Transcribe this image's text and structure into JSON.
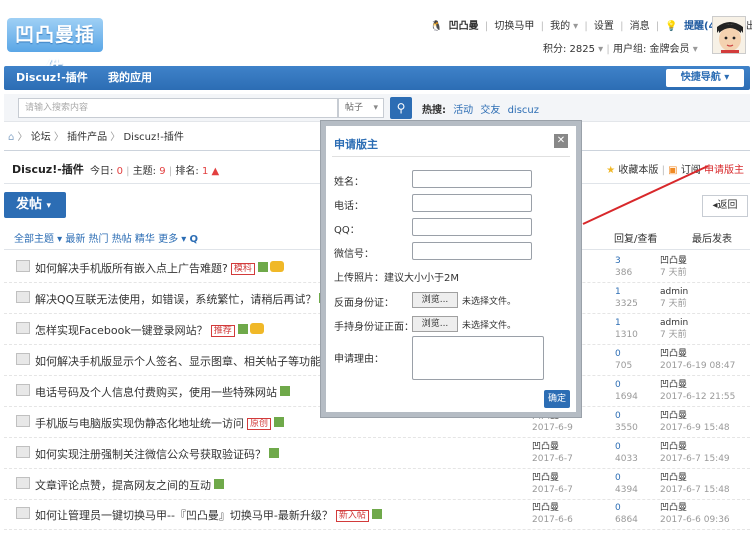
{
  "header": {
    "logo": "凹凸曼插件",
    "username": "凹凸曼",
    "toplinks": [
      "切换马甲",
      "我的",
      "设置",
      "消息",
      "提醒(4)",
      "退出"
    ],
    "credits": "积分: 2825",
    "group": "用户组: 金牌会员"
  },
  "nav": {
    "items": [
      "Discuz!-插件",
      "我的应用"
    ],
    "quick": "快捷导航"
  },
  "search": {
    "placeholder": "请输入搜索内容",
    "type": "帖子",
    "hot_label": "热搜:",
    "hot": [
      "活动",
      "交友",
      "discuz"
    ]
  },
  "breadcrumb": [
    "论坛",
    "插件产品",
    "Discuz!-插件"
  ],
  "forum": {
    "name": "Discuz!-插件",
    "today_label": "今日: ",
    "today": "0",
    "topics_label": "主题: ",
    "topics": "9",
    "rank_label": "排名: ",
    "rank": "1",
    "favorite": "收藏本版",
    "subscribe": "订阅",
    "apply": "申请版主"
  },
  "post_button": "发帖",
  "back_button": "返回",
  "list_header": {
    "filters": "全部主题 ▾  最新  热门  热帖  精华  更多 ▾",
    "col_reply": "回复/查看",
    "col_last": "最后发表"
  },
  "threads": [
    {
      "title": "如何解决手机版所有嵌入点上广告难题?",
      "tag": "模科",
      "author": "",
      "date": "",
      "replies": "3",
      "views": "386",
      "last_user": "凹凸曼",
      "last_time": "7 天前"
    },
    {
      "title": "解决QQ互联无法使用，如错误，系统繁忙，请稍后再试？",
      "tag": "",
      "author": "",
      "date": "",
      "replies": "1",
      "views": "3325",
      "last_user": "admin",
      "last_time": "7 天前"
    },
    {
      "title": "怎样实现Facebook一键登录网站？",
      "tag": "推荐",
      "author": "",
      "date": "",
      "replies": "1",
      "views": "1310",
      "last_user": "admin",
      "last_time": "7 天前"
    },
    {
      "title": "如何解决手机版显示个人签名、显示图章、相关帖子等功能",
      "tag": "",
      "author": "",
      "date": "",
      "replies": "0",
      "views": "705",
      "last_user": "凹凸曼",
      "last_time": "2017-6-19 08:47"
    },
    {
      "title": "电话号码及个人信息付费购买，使用一些特殊网站",
      "tag": "",
      "author": "",
      "date": "",
      "replies": "0",
      "views": "1694",
      "last_user": "凹凸曼",
      "last_time": "2017-6-12 21:55"
    },
    {
      "title": "手机版与电脑版实现伪静态化地址统一访问",
      "tag": "原创",
      "author": "凹凸曼",
      "date": "2017-6-9",
      "replies": "0",
      "views": "3550",
      "last_user": "凹凸曼",
      "last_time": "2017-6-9 15:48"
    },
    {
      "title": "如何实现注册强制关注微信公众号获取验证码？",
      "tag": "",
      "author": "凹凸曼",
      "date": "2017-6-7",
      "replies": "0",
      "views": "4033",
      "last_user": "凹凸曼",
      "last_time": "2017-6-7 15:49"
    },
    {
      "title": "文章评论点赞，提高网友之间的互动",
      "tag": "",
      "author": "凹凸曼",
      "date": "2017-6-7",
      "replies": "0",
      "views": "4394",
      "last_user": "凹凸曼",
      "last_time": "2017-6-7 15:48"
    },
    {
      "title": "如何让管理员一键切换马甲--『凹凸曼』切换马甲-最新升级？",
      "tag": "新入帖",
      "author": "凹凸曼",
      "date": "2017-6-6",
      "replies": "0",
      "views": "6864",
      "last_user": "凹凸曼",
      "last_time": "2017-6-6 09:36"
    }
  ],
  "modal": {
    "title": "申请版主",
    "name": "姓名：",
    "phone": "电话：",
    "qq": "QQ：",
    "wechat": "微信号：",
    "photo_note": "上传照片：建议大小小于2M",
    "id_back": "反面身份证：",
    "id_front": "手持身份证正面：",
    "browse": "浏览...",
    "no_file": "未选择文件。",
    "reason": "申请理由：",
    "confirm": "确定"
  }
}
